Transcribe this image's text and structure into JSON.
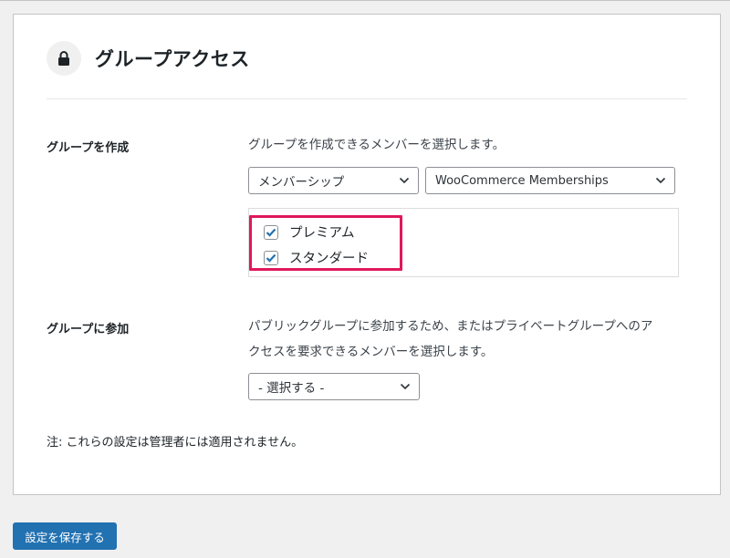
{
  "card": {
    "title": "グループアクセス",
    "icon": "lock-icon"
  },
  "create_group": {
    "label": "グループを作成",
    "description": "グループを作成できるメンバーを選択します。",
    "type_select": {
      "value": "メンバーシップ"
    },
    "source_select": {
      "value": "WooCommerce Memberships"
    },
    "options": [
      {
        "label": "プレミアム",
        "checked": true
      },
      {
        "label": "スタンダード",
        "checked": true
      }
    ]
  },
  "join_group": {
    "label": "グループに参加",
    "description_line1": "パブリックグループに参加するため、またはプライベートグループへのア",
    "description_line2": "クセスを要求できるメンバーを選択します。",
    "select": {
      "value": "- 選択する -"
    }
  },
  "note": "注: これらの設定は管理者には適用されません。",
  "save_button": "設定を保存する",
  "colors": {
    "accent": "#2271b1",
    "highlight": "#e0185c",
    "background": "#f0f0f1"
  }
}
